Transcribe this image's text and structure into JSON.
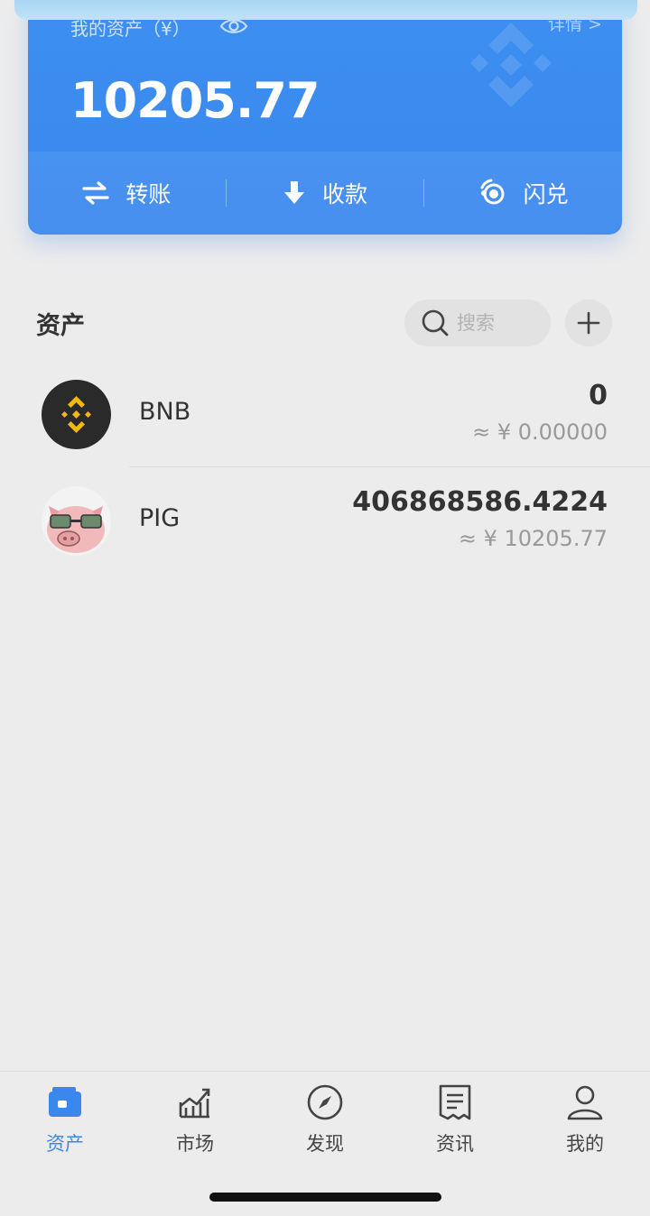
{
  "wallet": {
    "label": "我的资产（¥）",
    "detail": "详情 >",
    "total": "10205.77",
    "actions": [
      {
        "label": "转账",
        "icon": "transfer-icon"
      },
      {
        "label": "收款",
        "icon": "receive-icon"
      },
      {
        "label": "闪兑",
        "icon": "swap-icon"
      }
    ],
    "accent": "#3a87ee"
  },
  "assets": {
    "title": "资产",
    "search_placeholder": "搜索",
    "add_icon": "plus-icon",
    "tokens": [
      {
        "symbol": "BNB",
        "balance": "0",
        "fiat": "≈ ¥ 0.00000",
        "icon": "bnb-logo"
      },
      {
        "symbol": "PIG",
        "balance": "406868586.4224",
        "fiat": "≈ ¥ 10205.77",
        "icon": "pig-logo"
      }
    ]
  },
  "tabbar": {
    "tabs": [
      {
        "label": "资产",
        "icon": "wallet-icon",
        "active": true
      },
      {
        "label": "市场",
        "icon": "chart-icon",
        "active": false
      },
      {
        "label": "发现",
        "icon": "compass-icon",
        "active": false
      },
      {
        "label": "资讯",
        "icon": "news-icon",
        "active": false
      },
      {
        "label": "我的",
        "icon": "profile-icon",
        "active": false
      }
    ]
  }
}
